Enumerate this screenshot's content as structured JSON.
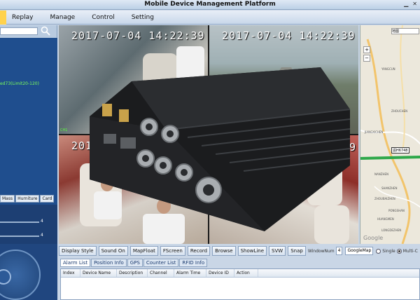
{
  "window": {
    "title": "Mobile Device Management Platform"
  },
  "menu": {
    "items": [
      "Replay",
      "Manage",
      "Control",
      "Setting"
    ]
  },
  "left_panel": {
    "search_placeholder": "",
    "tree_node": "ed73(Limit20-120)",
    "tabs": [
      "Mass",
      "Hurniture",
      "Card"
    ],
    "slider_values": [
      "4",
      "4"
    ]
  },
  "video": {
    "timestamps": [
      "2017-07-04  14:22:39",
      "2017-07-04  14:22:39",
      "2017",
      "39"
    ]
  },
  "toolbar": {
    "buttons": [
      "Display Style",
      "Sound On",
      "MapFloat",
      "FScreen",
      "Record",
      "Browse",
      "ShowLine",
      "SVW",
      "Snap"
    ],
    "window_num_label": "WindowNum",
    "window_num_value": "4",
    "map_select_value": "GoogleMap",
    "radio_single": "Single",
    "radio_multi": "Multi-C"
  },
  "bottom_tabs": [
    "Alarm List",
    "Position Info",
    "GPS",
    "Counter List",
    "RFID Info"
  ],
  "alarm_table": {
    "columns": [
      "Index",
      "Device Name",
      "Description",
      "Channel",
      "Alarm Time",
      "Device ID",
      "Action"
    ]
  },
  "map": {
    "search_text": "地图",
    "zoom_in": "+",
    "zoom_out": "−",
    "vehicle_label": "渝H6748",
    "attribution": "Google",
    "labels": [
      "YANGCUN",
      "ZHOUCHEN",
      "JIANGXICHEN",
      "NANZHEN",
      "SHANZHEN",
      "ZHOUBAIZHEN",
      "PONGSHAN",
      "HUANGMEN",
      "LONGDEZHEN"
    ]
  },
  "colors": {
    "accent": "#ffd24d",
    "panel": "#b9cbe0",
    "osd_green": "#57ff3a"
  }
}
